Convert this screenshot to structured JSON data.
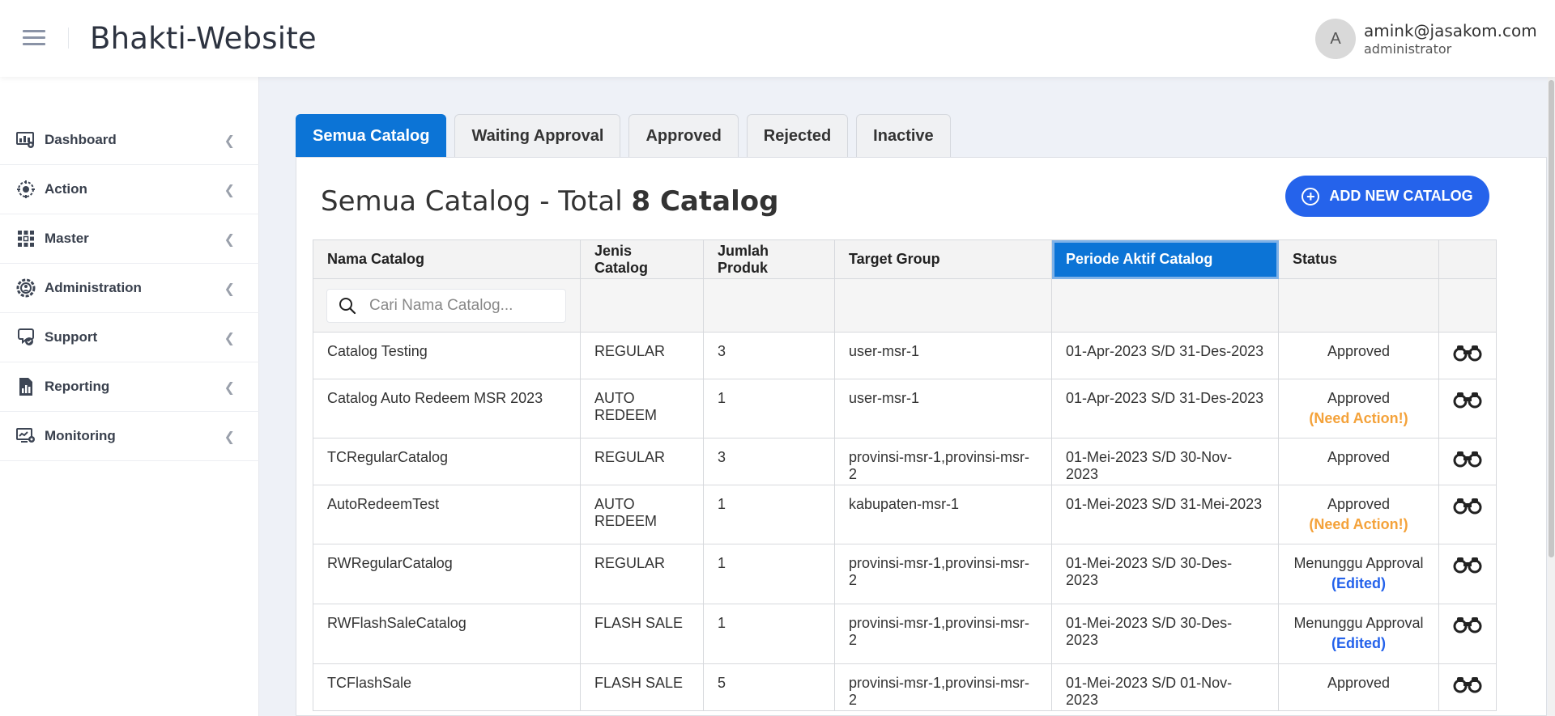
{
  "header": {
    "app_title": "Bhakti-Website",
    "user": {
      "avatar_initial": "A",
      "email": "amink@jasakom.com",
      "role": "administrator"
    }
  },
  "sidebar": {
    "items": [
      {
        "label": "Dashboard",
        "icon": "dashboard-icon"
      },
      {
        "label": "Action",
        "icon": "action-icon"
      },
      {
        "label": "Master",
        "icon": "master-icon"
      },
      {
        "label": "Administration",
        "icon": "administration-icon"
      },
      {
        "label": "Support",
        "icon": "support-icon"
      },
      {
        "label": "Reporting",
        "icon": "reporting-icon"
      },
      {
        "label": "Monitoring",
        "icon": "monitoring-icon"
      }
    ]
  },
  "tabs": [
    {
      "label": "Semua Catalog",
      "active": true
    },
    {
      "label": "Waiting Approval",
      "active": false
    },
    {
      "label": "Approved",
      "active": false
    },
    {
      "label": "Rejected",
      "active": false
    },
    {
      "label": "Inactive",
      "active": false
    }
  ],
  "page": {
    "title_prefix": "Semua Catalog - Total",
    "title_count": "8 Catalog",
    "add_button": "ADD NEW CATALOG"
  },
  "table": {
    "columns": [
      "Nama Catalog",
      "Jenis Catalog",
      "Jumlah Produk",
      "Target Group",
      "Periode Aktif Catalog",
      "Status",
      ""
    ],
    "search_placeholder": "Cari Nama Catalog...",
    "rows": [
      {
        "nama": "Catalog Testing",
        "jenis": "REGULAR",
        "jumlah": "3",
        "target": "user-msr-1",
        "periode": "01-Apr-2023 S/D 31-Des-2023",
        "status": "Approved",
        "note": ""
      },
      {
        "nama": "Catalog Auto Redeem MSR 2023",
        "jenis": "AUTO REDEEM",
        "jumlah": "1",
        "target": "user-msr-1",
        "periode": "01-Apr-2023 S/D 31-Des-2023",
        "status": "Approved",
        "note": "(Need Action!)"
      },
      {
        "nama": "TCRegularCatalog",
        "jenis": "REGULAR",
        "jumlah": "3",
        "target": "provinsi-msr-1,provinsi-msr-2",
        "periode": "01-Mei-2023 S/D 30-Nov-2023",
        "status": "Approved",
        "note": ""
      },
      {
        "nama": "AutoRedeemTest",
        "jenis": "AUTO REDEEM",
        "jumlah": "1",
        "target": "kabupaten-msr-1",
        "periode": "01-Mei-2023 S/D 31-Mei-2023",
        "status": "Approved",
        "note": "(Need Action!)"
      },
      {
        "nama": "RWRegularCatalog",
        "jenis": "REGULAR",
        "jumlah": "1",
        "target": "provinsi-msr-1,provinsi-msr-2",
        "periode": "01-Mei-2023 S/D 30-Des-2023",
        "status": "Menunggu Approval",
        "note": "(Edited)"
      },
      {
        "nama": "RWFlashSaleCatalog",
        "jenis": "FLASH SALE",
        "jumlah": "1",
        "target": "provinsi-msr-1,provinsi-msr-2",
        "periode": "01-Mei-2023 S/D 30-Des-2023",
        "status": "Menunggu Approval",
        "note": "(Edited)"
      },
      {
        "nama": "TCFlashSale",
        "jenis": "FLASH SALE",
        "jumlah": "5",
        "target": "provinsi-msr-1,provinsi-msr-2",
        "periode": "01-Mei-2023 S/D 01-Nov-2023",
        "status": "Approved",
        "note": ""
      }
    ]
  },
  "colors": {
    "primary": "#0c74d6",
    "button": "#2563eb",
    "need_action": "#f4a23a",
    "edited": "#2563eb"
  }
}
